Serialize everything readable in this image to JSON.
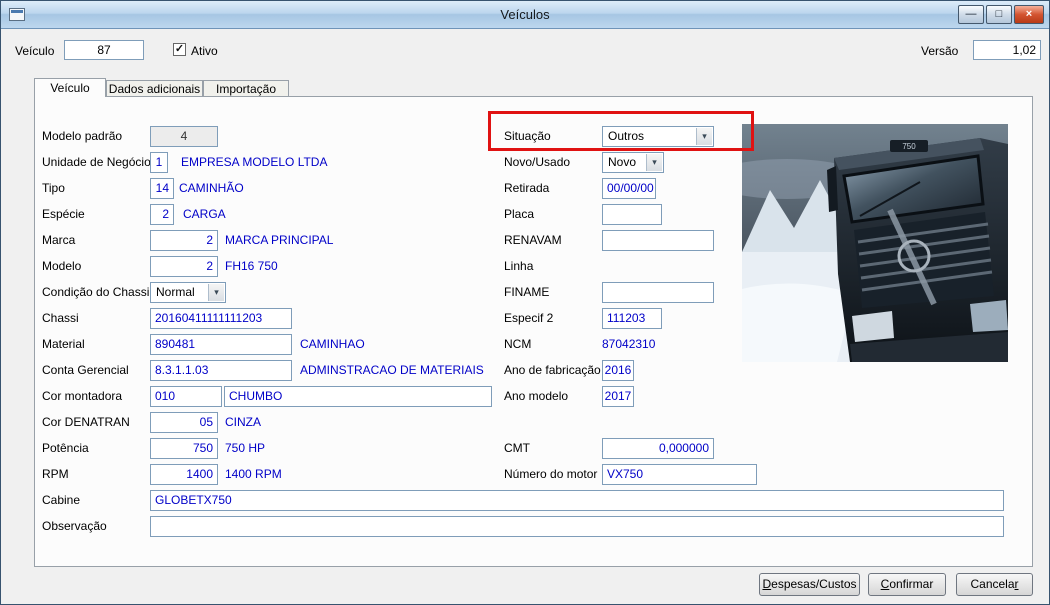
{
  "window": {
    "title": "Veículos"
  },
  "icons": {
    "minimize": "—",
    "maximize": "□",
    "close": "×",
    "dropdown": "▾",
    "check": "✓"
  },
  "header": {
    "vehicle_label": "Veículo",
    "vehicle_value": "87",
    "active_label": "Ativo",
    "version_label": "Versão",
    "version_value": "1,02"
  },
  "tabs": [
    {
      "label": "Veículo"
    },
    {
      "label": "Dados adicionais"
    },
    {
      "label": "Importação"
    }
  ],
  "form": {
    "left": {
      "modelo_padrao": {
        "label": "Modelo padrão",
        "value": "4"
      },
      "unidade_negocio": {
        "label": "Unidade de Negócio",
        "code": "1",
        "desc": "EMPRESA MODELO LTDA"
      },
      "tipo": {
        "label": "Tipo",
        "code": "14",
        "desc": "CAMINHÃO"
      },
      "especie": {
        "label": "Espécie",
        "code": "2",
        "desc": "CARGA"
      },
      "marca": {
        "label": "Marca",
        "code": "2",
        "desc": "MARCA PRINCIPAL"
      },
      "modelo": {
        "label": "Modelo",
        "code": "2",
        "desc": "FH16 750"
      },
      "condicao_chassi": {
        "label": "Condição do Chassi",
        "value": "Normal"
      },
      "chassi": {
        "label": "Chassi",
        "value": "20160411111111203"
      },
      "material": {
        "label": "Material",
        "code": "890481",
        "desc": "CAMINHAO"
      },
      "conta_gerencial": {
        "label": "Conta Gerencial",
        "code": "8.3.1.1.03",
        "desc": "ADMINSTRACAO DE MATERIAIS"
      },
      "cor_montadora": {
        "label": "Cor montadora",
        "code": "010",
        "desc": "CHUMBO"
      },
      "cor_denatran": {
        "label": "Cor DENATRAN",
        "code": "05",
        "desc": "CINZA"
      },
      "potencia": {
        "label": "Potência",
        "code": "750",
        "desc": "750 HP"
      },
      "rpm": {
        "label": "RPM",
        "code": "1400",
        "desc": "1400 RPM"
      },
      "cabine": {
        "label": "Cabine",
        "value": "GLOBETX750"
      },
      "observacao": {
        "label": "Observação",
        "value": ""
      }
    },
    "right": {
      "situacao": {
        "label": "Situação",
        "value": "Outros"
      },
      "novo_usado": {
        "label": "Novo/Usado",
        "value": "Novo"
      },
      "retirada": {
        "label": "Retirada",
        "value": "00/00/00"
      },
      "placa": {
        "label": "Placa",
        "value": ""
      },
      "renavam": {
        "label": "RENAVAM",
        "value": ""
      },
      "linha": {
        "label": "Linha"
      },
      "finame": {
        "label": "FINAME",
        "value": ""
      },
      "especif2": {
        "label": "Especif 2",
        "value": "111203"
      },
      "ncm": {
        "label": "NCM",
        "value": "87042310"
      },
      "ano_fabricacao": {
        "label": "Ano de fabricação",
        "value": "2016"
      },
      "ano_modelo": {
        "label": "Ano modelo",
        "value": "2017"
      },
      "cmt": {
        "label": "CMT",
        "value": "0,000000"
      },
      "numero_motor": {
        "label": "Número do motor",
        "value": "VX750"
      }
    }
  },
  "photo": {
    "badge": "750"
  },
  "footer": {
    "despesas": {
      "pre": "",
      "u": "D",
      "post": "espesas/Custos"
    },
    "confirmar": {
      "pre": "",
      "u": "C",
      "post": "onfirmar"
    },
    "cancelar": {
      "pre": "Cancela",
      "u": "r",
      "post": ""
    }
  },
  "colors": {
    "highlight_red": "#e01212",
    "value_blue": "#0000c8",
    "titlebar_blue": "#bcd6ee"
  }
}
